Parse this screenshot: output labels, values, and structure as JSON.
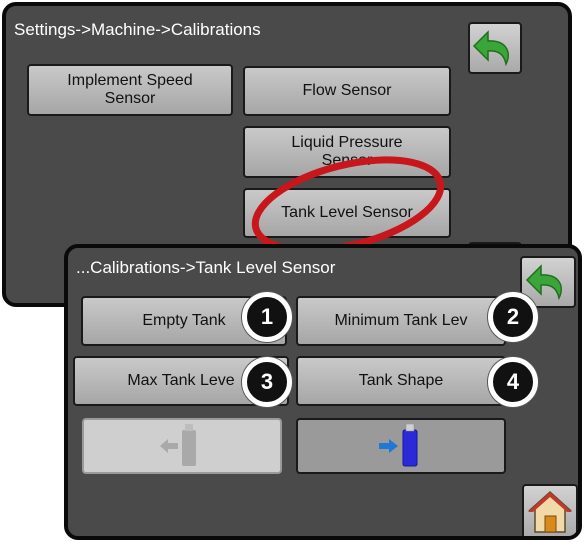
{
  "back_screen": {
    "breadcrumb": "Settings->Machine->Calibrations",
    "buttons": {
      "implement_speed_line1": "Implement Speed",
      "implement_speed_line2": "Sensor",
      "flow_sensor": "Flow Sensor",
      "liquid_pressure_line1": "Liquid Pressure",
      "liquid_pressure_line2": "Sensor",
      "tank_level_sensor": "Tank Level Sensor"
    }
  },
  "front_screen": {
    "breadcrumb": "...Calibrations->Tank Level Sensor",
    "buttons": {
      "empty_tank": "Empty Tank",
      "minimum_tank_level": "Minimum Tank Lev",
      "max_tank_level": "Max Tank Leve",
      "tank_shape": "Tank Shape"
    },
    "callouts": [
      "1",
      "2",
      "3",
      "4"
    ]
  },
  "icons": {
    "back": "back-arrow-icon",
    "home": "home-icon",
    "usb_import": "usb-import-icon",
    "usb_export": "usb-export-icon"
  },
  "colors": {
    "panel_bg": "#4a4a4a",
    "button_bg": "#b8b8b8",
    "back_arrow": "#3aa63a",
    "highlight": "#c8161d",
    "usb_arrow": "#1e78d4",
    "usb_drive": "#2a2ad8"
  }
}
